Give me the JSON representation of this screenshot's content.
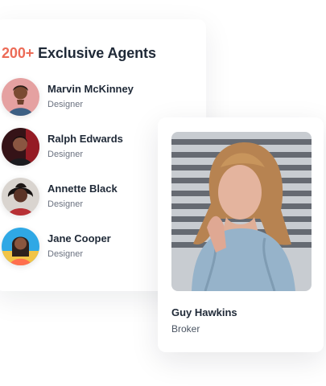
{
  "agents_panel": {
    "title_count": "200+",
    "title_text": "Exclusive Agents",
    "accent_color": "#ec6b57",
    "agents": [
      {
        "name": "Marvin McKinney",
        "role": "Designer",
        "avatar_icon": "man-portrait-icon"
      },
      {
        "name": "Ralph Edwards",
        "role": "Designer",
        "avatar_icon": "man-portrait-icon"
      },
      {
        "name": "Annette Black",
        "role": "Designer",
        "avatar_icon": "person-portrait-icon"
      },
      {
        "name": "Jane Cooper",
        "role": "Designer",
        "avatar_icon": "woman-portrait-icon"
      }
    ]
  },
  "featured_agent": {
    "name": "Guy Hawkins",
    "role": "Broker",
    "photo_icon": "woman-portrait-photo"
  }
}
